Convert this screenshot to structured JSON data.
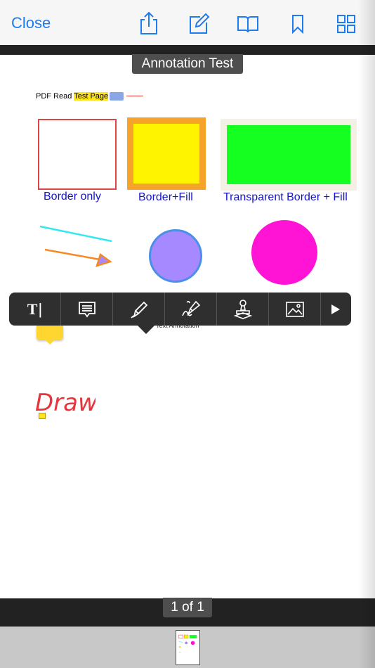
{
  "topbar": {
    "close_label": "Close",
    "icons": [
      "share-icon",
      "edit-icon",
      "book-icon",
      "bookmark-icon",
      "grid-icon"
    ],
    "accent": "#1e7cf0"
  },
  "document": {
    "title": "Annotation Test",
    "header_text": "PDF Read",
    "header_highlight": "Test Page",
    "captions": {
      "border_only": "Border only",
      "border_fill": "Border+Fill",
      "transparent": "Transparent Border + Fill"
    },
    "text_annotation": "Text Annotation",
    "ink_label": "Draw",
    "colors": {
      "caption_blue": "#1414cc",
      "border_red": "#e04545",
      "fill_yellow": "#fff400",
      "fill_green": "#15ff20",
      "circle_purple": "#a688ff",
      "circle_magenta": "#ff14d6"
    }
  },
  "annotation_toolbar": {
    "tools": [
      {
        "name": "text-tool",
        "label": "T"
      },
      {
        "name": "note-tool"
      },
      {
        "name": "pen-tool"
      },
      {
        "name": "signature-tool"
      },
      {
        "name": "stamp-tool"
      },
      {
        "name": "image-tool"
      },
      {
        "name": "more-tool"
      }
    ]
  },
  "footer": {
    "page_indicator": "1 of 1"
  }
}
